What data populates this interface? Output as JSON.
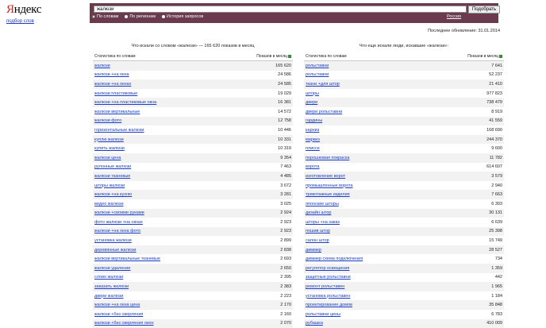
{
  "logo": {
    "y": "Я",
    "rest": "ндекс"
  },
  "subtitle_link": "подбор слов",
  "search": {
    "value": "жалюзи",
    "button": "Подобрать"
  },
  "modes": [
    {
      "label": "По словам",
      "selected": true
    },
    {
      "label": "По регионам",
      "selected": false
    },
    {
      "label": "История запросов",
      "selected": false
    }
  ],
  "region": "Россия",
  "updated": "Последнее обновление: 31.01.2014",
  "left": {
    "title": "Что искали со словом «жалюзи» — 165 620 показов в месяц",
    "col1": "Статистика по словам",
    "col2": "Показов в месяц",
    "rows": [
      [
        "жалюзи",
        "165 620"
      ],
      [
        "жалюзи +на окна",
        "24 586"
      ],
      [
        "жалюзи +на окнах",
        "24 585"
      ],
      [
        "жалюзи пластиковые",
        "19 029"
      ],
      [
        "жалюзи +на пластиковые окна",
        "16 381"
      ],
      [
        "жалюзи вертикальные",
        "14 572"
      ],
      [
        "жалюзи фото",
        "12 758"
      ],
      [
        "горизонтальные жалюзи",
        "10 446"
      ],
      [
        "куплю жалюзи",
        "10 331"
      ],
      [
        "купить жалюзи",
        "10 319"
      ],
      [
        "жалюзи цена",
        "9 354"
      ],
      [
        "рулонные жалюзи",
        "7 463"
      ],
      [
        "жалюзи тканевые",
        "4 485"
      ],
      [
        "шторы жалюзи",
        "3 672"
      ],
      [
        "жалюзи +на кухню",
        "3 281"
      ],
      [
        "видео жалюзи",
        "3 025"
      ],
      [
        "жалюзи +своими руками",
        "2 924"
      ],
      [
        "фото жалюзи +на окнах",
        "2 923"
      ],
      [
        "жалюзи +на окна фото",
        "2 923"
      ],
      [
        "установка жалюзи",
        "2 899"
      ],
      [
        "деревянные жалюзи",
        "2 838"
      ],
      [
        "жалюзи вертикальные тканевые",
        "2 693"
      ],
      [
        "жалюзи удаление",
        "2 650"
      ],
      [
        "слово жалюзи",
        "2 395"
      ],
      [
        "заказать жалюзи",
        "2 383"
      ],
      [
        "двери жалюзи",
        "2 223"
      ],
      [
        "жалюзи +на окна цена",
        "2 170"
      ],
      [
        "жалюзи +без сверления",
        "2 160"
      ],
      [
        "жалюзи +без сверления окон",
        "2 070"
      ]
    ]
  },
  "right": {
    "title": "Что еще искали люди, искавшие «жалюзи»:",
    "col1": "Статистика по словам",
    "col2": "Показов в месяц",
    "rows": [
      [
        "рольставни",
        "7 641"
      ],
      [
        "рольставни",
        "52 237"
      ],
      [
        "ткани +для штор",
        "21 410"
      ],
      [
        "шторы",
        "977 823"
      ],
      [
        "двери",
        "738 479"
      ],
      [
        "двери рольставни",
        "8 919"
      ],
      [
        "гардины",
        "41 559"
      ],
      [
        "карниз",
        "168 690"
      ],
      [
        "маркиз",
        "244 370"
      ],
      [
        "плиссе",
        "9 600"
      ],
      [
        "порошковая покраска",
        "11 782"
      ],
      [
        "ворота",
        "614 607"
      ],
      [
        "изготовление ворот",
        "3 579"
      ],
      [
        "промышленные ворота",
        "2 940"
      ],
      [
        "трикотажные изделия",
        "7 663"
      ],
      [
        "японские шторы",
        "6 393"
      ],
      [
        "дизайн штор",
        "30 131"
      ],
      [
        "шторы +на заказ",
        "6 639"
      ],
      [
        "пошив штор",
        "25 398"
      ],
      [
        "салон штор",
        "15 749"
      ],
      [
        "диммер",
        "28 527"
      ],
      [
        "диммер схема подключения",
        "734"
      ],
      [
        "регулятор освещения",
        "1 359"
      ],
      [
        "защитные рольставни",
        "442"
      ],
      [
        "ремонт рольставен",
        "1 965"
      ],
      [
        "установка рольставен",
        "1 184"
      ],
      [
        "проектирование домов",
        "35 848"
      ],
      [
        "рольставни цены",
        "6 783"
      ],
      [
        "рубашка",
        "410 009"
      ]
    ]
  }
}
